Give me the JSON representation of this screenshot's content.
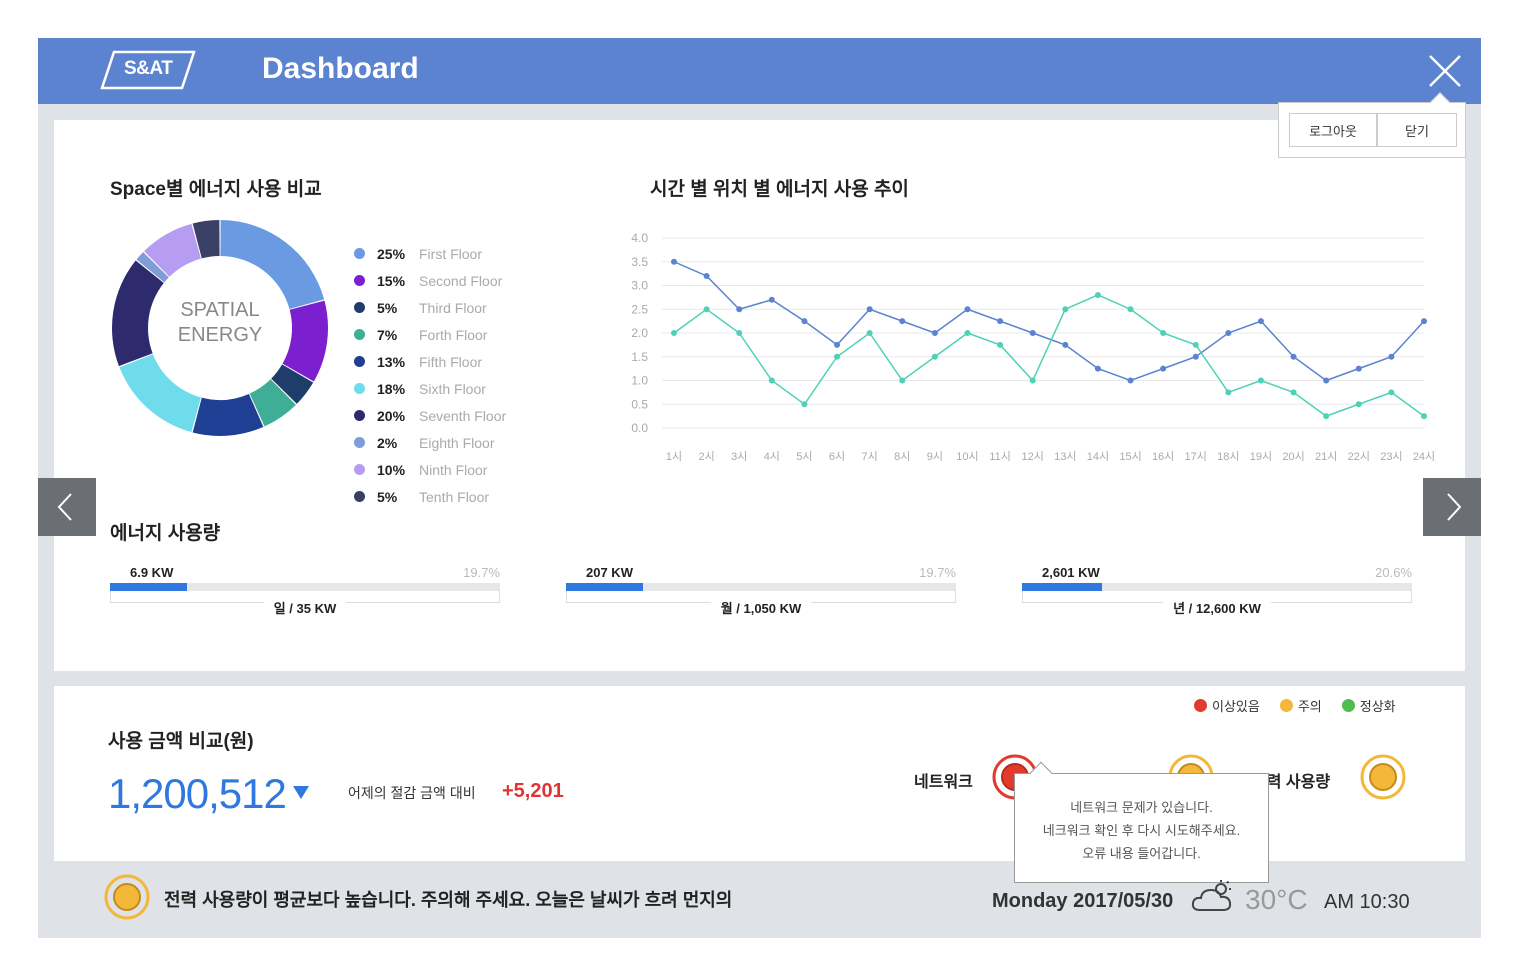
{
  "header": {
    "logo_text": "S&AT",
    "title": "Dashboard"
  },
  "account_menu": {
    "logout_label": "로그아웃",
    "close_label": "닫기"
  },
  "space_energy": {
    "title": "Space별 에너지 사용 비교",
    "center_line1": "SPATIAL",
    "center_line2": "ENERGY",
    "items": [
      {
        "pct": "25%",
        "label": "First Floor",
        "color": "#6a9be2"
      },
      {
        "pct": "15%",
        "label": "Second Floor",
        "color": "#7b1fcf"
      },
      {
        "pct": "5%",
        "label": "Third Floor",
        "color": "#1f3d6b"
      },
      {
        "pct": "7%",
        "label": "Forth Floor",
        "color": "#3fae96"
      },
      {
        "pct": "13%",
        "label": "Fifth Floor",
        "color": "#1f3f95"
      },
      {
        "pct": "18%",
        "label": "Sixth Floor",
        "color": "#6fdcec"
      },
      {
        "pct": "20%",
        "label": "Seventh Floor",
        "color": "#2d2a6e"
      },
      {
        "pct": "2%",
        "label": "Eighth Floor",
        "color": "#7f9ed9"
      },
      {
        "pct": "10%",
        "label": "Ninth Floor",
        "color": "#b79df2"
      },
      {
        "pct": "5%",
        "label": "Tenth Floor",
        "color": "#3a3f66"
      }
    ]
  },
  "chart_data": {
    "type": "line",
    "title": "시간 별 위치 별 에너지 사용 추이",
    "x": [
      "1시",
      "2시",
      "3시",
      "4시",
      "5시",
      "6시",
      "7시",
      "8시",
      "9시",
      "10시",
      "11시",
      "12시",
      "13시",
      "14시",
      "15시",
      "16시",
      "17시",
      "18시",
      "19시",
      "20시",
      "21시",
      "22시",
      "23시",
      "24시"
    ],
    "ylim": [
      0,
      4.0
    ],
    "yticks": [
      "4.0",
      "3.5",
      "3.0",
      "2.5",
      "2.0",
      "1.5",
      "1.0",
      "0.5",
      "0.0"
    ],
    "grid": true,
    "series": [
      {
        "color": "#5b83cf",
        "values": [
          3.5,
          3.2,
          2.5,
          2.7,
          2.25,
          1.75,
          2.5,
          2.25,
          2.0,
          2.5,
          2.25,
          2.0,
          1.75,
          1.25,
          1.0,
          1.25,
          1.5,
          2.0,
          2.25,
          1.5,
          1.0,
          1.25,
          1.5,
          2.25
        ]
      },
      {
        "color": "#4fd1b6",
        "values": [
          2.0,
          2.5,
          2.0,
          1.0,
          0.5,
          1.5,
          2.0,
          1.0,
          1.5,
          2.0,
          1.75,
          1.0,
          2.5,
          2.8,
          2.5,
          2.0,
          1.75,
          0.75,
          1.0,
          0.75,
          0.25,
          0.5,
          0.75,
          0.25
        ]
      }
    ]
  },
  "energy_usage": {
    "title": "에너지 사용량",
    "cards": [
      {
        "kw": "6.9 KW",
        "pct": "19.7%",
        "fill": 0.197,
        "total": "일 / 35 KW"
      },
      {
        "kw": "207 KW",
        "pct": "19.7%",
        "fill": 0.197,
        "total": "월 / 1,050 KW"
      },
      {
        "kw": "2,601 KW",
        "pct": "20.6%",
        "fill": 0.206,
        "total": "년 / 12,600 KW"
      }
    ]
  },
  "cost": {
    "title": "사용 금액 비교(원)",
    "value": "1,200,512",
    "compare_label": "어제의 절감 금액 대비",
    "diff": "+5,201"
  },
  "status_legend": [
    {
      "label": "이상있음",
      "color": "#e23b2e"
    },
    {
      "label": "주의",
      "color": "#f3b73a"
    },
    {
      "label": "정상화",
      "color": "#4fbe4f"
    }
  ],
  "status": {
    "network_label": "네트워크",
    "power_label": "전력 사용량"
  },
  "tooltip": {
    "line1": "네트워크 문제가 있습니다.",
    "line2": "네크워크 확인 후 다시 시도해주세요.",
    "line3": "오류 내용 들어갑니다."
  },
  "footer": {
    "alert": "전력 사용량이 평균보다 높습니다. 주의해 주세요. 오늘은 날씨가 흐려 먼지의",
    "date": "Monday 2017/05/30",
    "temperature": "30°C",
    "time": "AM 10:30"
  }
}
